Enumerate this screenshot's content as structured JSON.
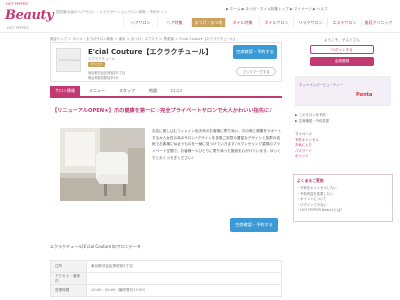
{
  "header": {
    "logo_small": "HOT PEPPER",
    "logo_main": "Beauty",
    "logo_sub": "HOT PEPPER",
    "tagline": "国内最大級のヘアサロン・リラクゼーションサロン検索・予約サイト",
    "top_links": "▶ ホーム  ▶ まつげ・ネイル特集トップ  ▶ マイページ  ▶ ヘルプ",
    "nav": [
      "ヘアサロン",
      "ヘア特集",
      "まつげ・まつ毛",
      "ネイル特集",
      "ネイルサロン",
      "リラクサロン",
      "エステサロン",
      "美容クリニック"
    ],
    "nav_active_index": 2
  },
  "breadcrumb": "美容トップ ＞ ネイル・まつげサロン検索 ＞ 東京 ＞ まつげ・エクステ ＞ 表参道 ＞ E'cial Couture【エクラクチュール】",
  "salon": {
    "logo_text": "E'cial Couture",
    "name": "E'cial Couture【エクラクチュール】",
    "kana": "エクラクチュール",
    "badge": "マツエク",
    "address": "東京都渋谷区神宮前5丁目",
    "access": "明治神宮前駅徒歩5分",
    "reserve_label": "空席確認・予約する",
    "favorite_label": "ブックマークする"
  },
  "tabs": [
    {
      "label": "サロン情報"
    },
    {
      "label": "メニュー"
    },
    {
      "label": "スタッフ"
    },
    {
      "label": "地図"
    },
    {
      "label": "口コミ"
    }
  ],
  "active_tab_index": 0,
  "catch_copy": "【リニューアルOPEN★】爪の健康を第一に☆完全プライベートサロンで大人かわいい指先に♪",
  "intro": "お店に差し込むフィレイン色天気のお客様に寄り添い、爪の美と健康をサポートする大人女性の為のサロン♪デザインを多数ご用意の豊富なデザインと抜群の技術でお客様に似合うものを一緒に見つけていきます♪カウンセリング重視のプライベート空間で、お客様一人ひとりに寄り添った施術を心がけています。ゆっくりとおくつろぎください♪",
  "reserve_label_2": "空席確認・予約する",
  "data_title": "エクラクチュール[E'cial Couture]のサロンデータ",
  "data_rows": [
    {
      "th": "住所",
      "tv": "東京都渋谷区神宮前5丁目"
    },
    {
      "th": "アクセス・道案内",
      "tv": ""
    },
    {
      "th": "営業時間",
      "tv": "10:00 - 20:00（最終受付17:00）"
    }
  ],
  "sidebar": {
    "login_head": "ようこそ、ゲストさん",
    "login_label": "ログインする",
    "register_label": "会員登録",
    "promo_text": "ホットペッパービューティー",
    "promo_brand": "Ponta",
    "links": "▶ このサロンを予約\n▶ 空席確認・予約変更",
    "mypage_head": "マイページ",
    "mypage_items": [
      "予約キャンセル",
      "お気に入り",
      "パスワード",
      "ポイント"
    ],
    "notice_title": "よくあるご質問",
    "notice_text": "・予約をキャンセルしたい\n・予約内容を変更したい\n・ポイントについて\n・ログインできない\n・HOT PEPPER Beautyとは？"
  },
  "colors": {
    "brand": "#c23a72",
    "accent_gold": "#c9a25e",
    "reserve_blue": "#3b9ad6"
  }
}
